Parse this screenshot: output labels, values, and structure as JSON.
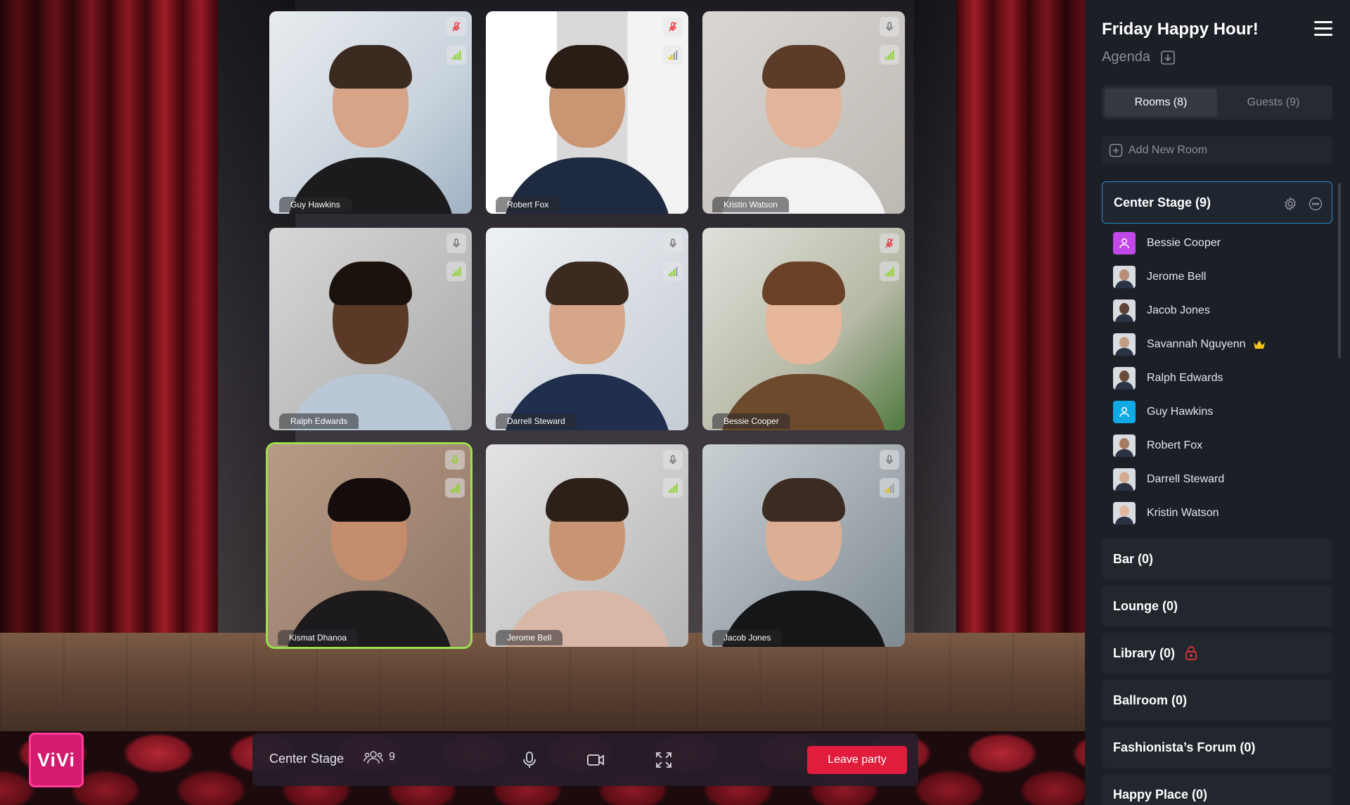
{
  "event": {
    "title": "Friday Happy Hour!",
    "agenda_label": "Agenda"
  },
  "tabs": [
    {
      "label": "Rooms (8)",
      "selected": true
    },
    {
      "label": "Guests (9)",
      "selected": false
    }
  ],
  "add_room_label": "Add New Room",
  "active_room": {
    "label": "Center Stage (9)",
    "members": [
      {
        "name": "Bessie Cooper",
        "avatar": "user-icon",
        "avatar_color": "#c147e9"
      },
      {
        "name": "Jerome Bell",
        "avatar": "photo"
      },
      {
        "name": "Jacob Jones",
        "avatar": "photo"
      },
      {
        "name": "Savannah Nguyenn",
        "avatar": "photo",
        "host": true
      },
      {
        "name": "Ralph Edwards",
        "avatar": "photo"
      },
      {
        "name": "Guy Hawkins",
        "avatar": "user-icon",
        "avatar_color": "#0fa9e6"
      },
      {
        "name": "Robert Fox",
        "avatar": "photo"
      },
      {
        "name": "Darrell Steward",
        "avatar": "photo"
      },
      {
        "name": "Kristin Watson",
        "avatar": "photo"
      }
    ]
  },
  "other_rooms": [
    {
      "label": "Bar (0)",
      "locked": false
    },
    {
      "label": "Lounge (0)",
      "locked": false
    },
    {
      "label": "Library (0)",
      "locked": true
    },
    {
      "label": "Ballroom (0)",
      "locked": false
    },
    {
      "label": "Fashionista’s Forum (0)",
      "locked": false
    },
    {
      "label": "Happy Place (0)",
      "locked": false
    }
  ],
  "participants": [
    {
      "name": "Guy Hawkins",
      "mic": "muted",
      "signal": "strong"
    },
    {
      "name": "Robert Fox",
      "mic": "muted",
      "signal": "weak"
    },
    {
      "name": "Kristin Watson",
      "mic": "on",
      "signal": "strong"
    },
    {
      "name": "Ralph Edwards",
      "mic": "on",
      "signal": "strong"
    },
    {
      "name": "Darrell Steward",
      "mic": "on",
      "signal": "medium"
    },
    {
      "name": "Bessie Cooper",
      "mic": "muted",
      "signal": "strong"
    },
    {
      "name": "Kismat Dhanoa",
      "mic": "speaking",
      "signal": "strong",
      "active_speaker": true
    },
    {
      "name": "Jerome Bell",
      "mic": "on",
      "signal": "strong"
    },
    {
      "name": "Jacob Jones",
      "mic": "on",
      "signal": "weak"
    }
  ],
  "controlbar": {
    "room_name": "Center Stage",
    "participant_count": "9",
    "leave_label": "Leave party"
  },
  "logo": {
    "text": "ViVi"
  },
  "colors": {
    "accent_blue": "#2c8ccf",
    "leave_red": "#e01d3c",
    "signal_green": "#8ed22c",
    "logo_pink": "#d41b6f",
    "crown_yellow": "#f5c518",
    "lock_red": "#e8333f"
  }
}
